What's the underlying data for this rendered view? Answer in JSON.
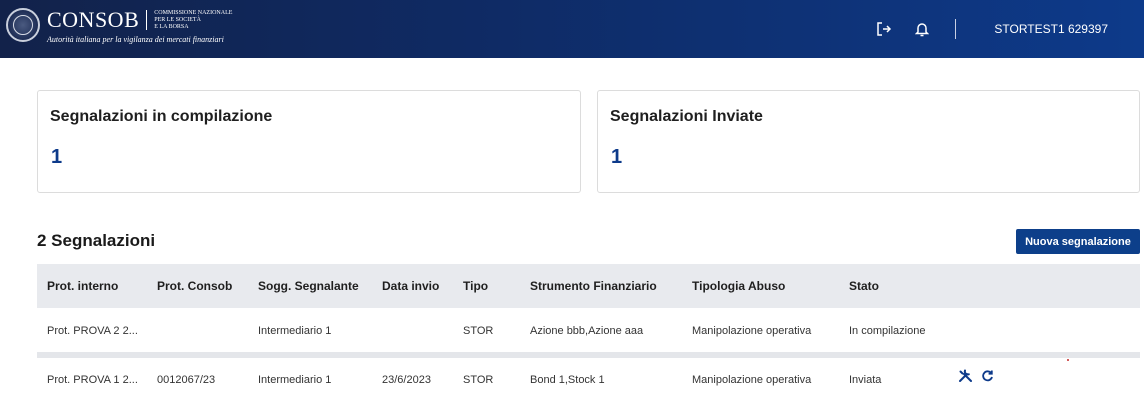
{
  "header": {
    "brand_name": "CONSOB",
    "brand_sub": [
      "COMMISSIONE NAZIONALE",
      "PER LE SOCIETÀ",
      "E LA BORSA"
    ],
    "tagline": "Autorità italiana per la vigilanza dei mercati finanziari",
    "username": "STORTEST1 629397",
    "icons": [
      "logout-icon",
      "bell-icon"
    ]
  },
  "cards": [
    {
      "title": "Segnalazioni in compilazione",
      "value": "1"
    },
    {
      "title": "Segnalazioni Inviate",
      "value": "1"
    }
  ],
  "list": {
    "title": "2 Segnalazioni",
    "new_button": "Nuova segnalazione"
  },
  "table": {
    "headers": [
      "Prot. interno",
      "Prot. Consob",
      "Sogg. Segnalante",
      "Data invio",
      "Tipo",
      "Strumento Finanziario",
      "Tipologia Abuso",
      "Stato"
    ],
    "rows": [
      [
        "Prot. PROVA 2 2...",
        "",
        "Intermediario 1",
        "",
        "STOR",
        "Azione bbb,Azione aaa",
        "Manipolazione operativa",
        "In compilazione"
      ],
      [
        "Prot. PROVA 1 2...",
        "0012067/23",
        "Intermediario 1",
        "23/6/2023",
        "STOR",
        "Bond 1,Stock 1",
        "Manipolazione operativa",
        "Inviata"
      ]
    ],
    "row_actions": [
      "tools-icon",
      "refresh-icon"
    ]
  },
  "colors": {
    "header_bg": "#0f2a63",
    "accent": "#0d3a8a",
    "table_header_bg": "#e8eaee"
  }
}
